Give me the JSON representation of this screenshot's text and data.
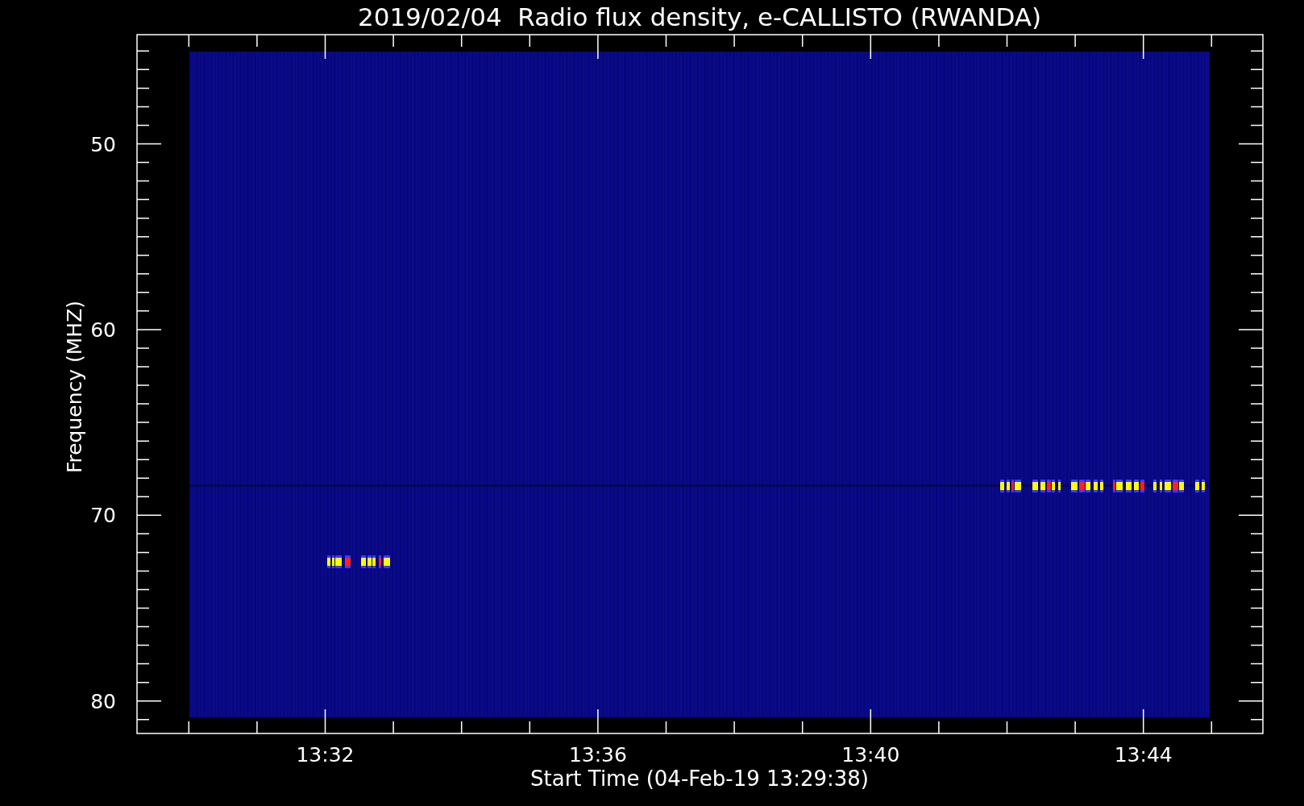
{
  "title": "2019/02/04  Radio flux density, e-CALLISTO (RWANDA)",
  "y_axis": {
    "label": "Frequency (MHZ)",
    "ticks": [
      "50",
      "60",
      "70",
      "80"
    ]
  },
  "x_axis": {
    "label": "Start Time (04-Feb-19 13:29:38)",
    "ticks": [
      "13:32",
      "13:36",
      "13:40",
      "13:44"
    ]
  }
}
